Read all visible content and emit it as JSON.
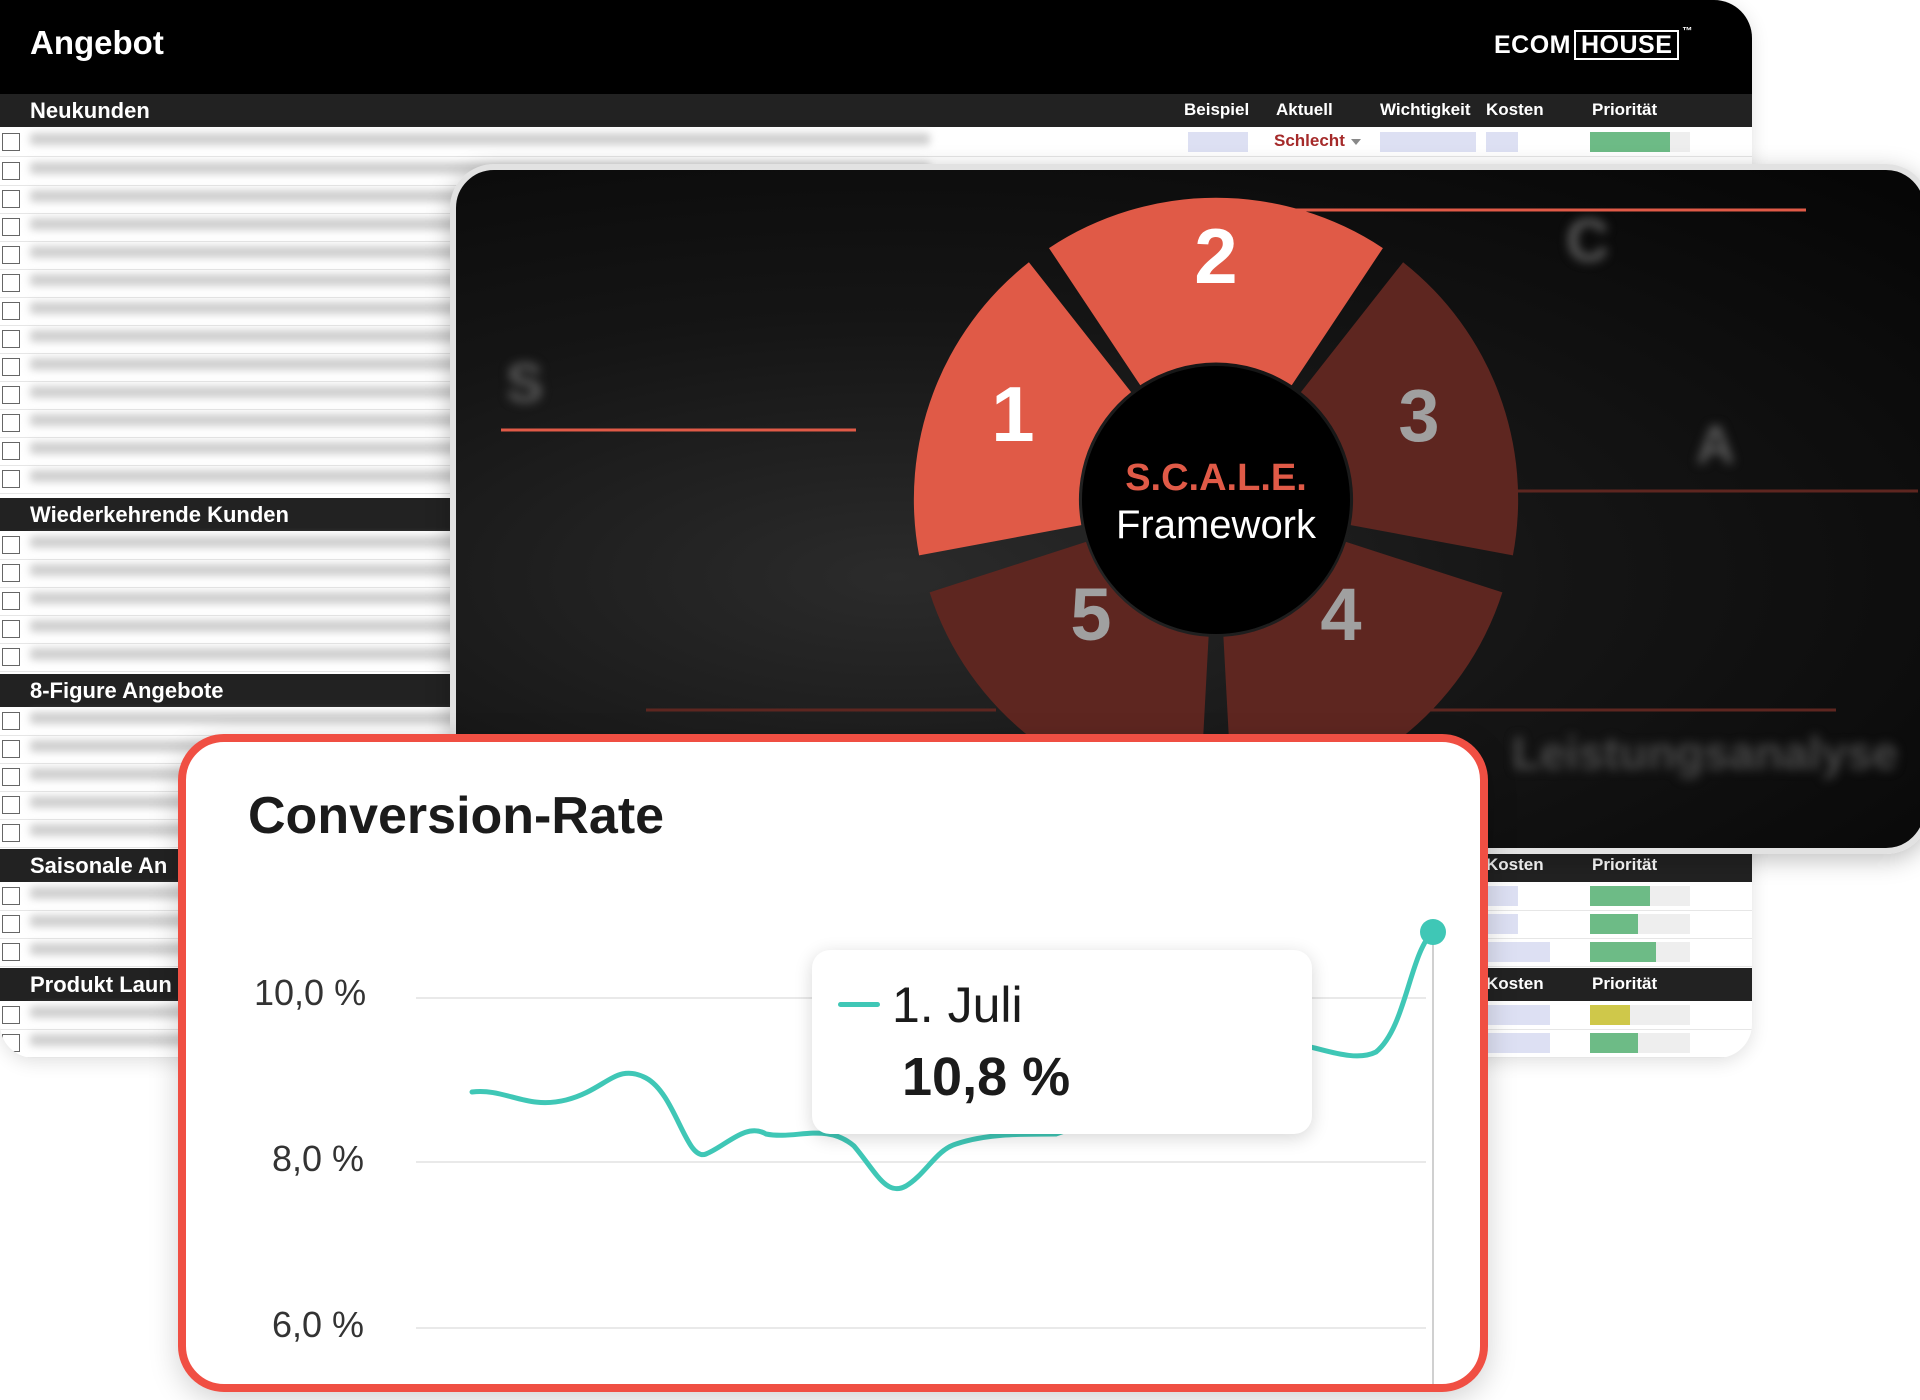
{
  "sheet": {
    "title": "Angebot",
    "logo_left": "ECOM",
    "logo_right": "HOUSE",
    "logo_mark": "™",
    "columns": {
      "beispiel": "Beispiel",
      "aktuell": "Aktuell",
      "wichtigkeit": "Wichtigkeit",
      "kosten": "Kosten",
      "prioritaet": "Priorität"
    },
    "sections": [
      {
        "name": "Neukunden"
      },
      {
        "name": "Wiederkehrende Kunden"
      },
      {
        "name": "8-Figure Angebote"
      },
      {
        "name": "Saisonale An"
      },
      {
        "name": "Produkt Laun"
      }
    ],
    "first_row_status": "Schlecht",
    "priority_rows": [
      {
        "level": 0.8,
        "color": "#6dbb86"
      },
      {
        "level": 0.6,
        "color": "#6dbb86"
      },
      {
        "level": 0.48,
        "color": "#6dbb86"
      },
      {
        "level": 0.66,
        "color": "#6dbb86"
      },
      {
        "level": 0.4,
        "color": "#cfc84a"
      },
      {
        "level": 0.48,
        "color": "#6dbb86"
      }
    ]
  },
  "framework": {
    "brand": "S.C.A.L.E.",
    "label": "Framework",
    "segments": [
      "1",
      "2",
      "3",
      "4",
      "5"
    ],
    "leistungsanalyse": "Leistungsanalyse",
    "colors": {
      "active": "#e05a47",
      "inactive": "#5e2620"
    }
  },
  "conversion": {
    "title": "Conversion-Rate",
    "y_ticks": [
      "10,0 %",
      "8,0 %",
      "6,0 %"
    ],
    "tooltip_date": "1. Juli",
    "tooltip_value": "10,8 %",
    "line_color": "#3fc7b6",
    "accent_color": "#f04f43"
  }
}
